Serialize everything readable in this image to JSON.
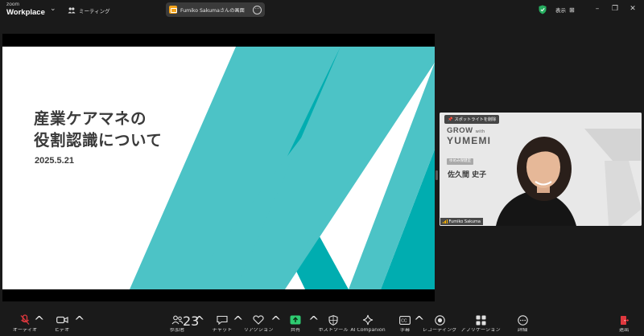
{
  "titlebar": {
    "brand_top": "zoom",
    "brand_bottom": "Workplace",
    "meeting_label": "ミーティング",
    "share_banner": "Fumiko Sakumaさんの画面",
    "view_label": "表示",
    "accent_shield": "#27ae60",
    "share_app_color": "#f4a31a"
  },
  "slide": {
    "title_line1": "産業ケアマネの",
    "title_line2": "役割認識について",
    "date": "2025.5.21",
    "teal_light": "#4cc3c6",
    "teal_dark": "#00adb0"
  },
  "video": {
    "spotlight_button": "スポットライトを削除",
    "logo_line1": "GROW",
    "logo_with": "with",
    "logo_line2": "YUMEMI",
    "role_badge": "ゆめみ保健室",
    "person_name": "佐久間 史子",
    "name_tag": "Fumiko Sakuma"
  },
  "toolbar": {
    "audio_label": "オーディオ",
    "video_label": "ビデオ",
    "participants_label": "参加者",
    "participants_count": "23",
    "chat_label": "チャット",
    "reactions_label": "リアクション",
    "share_label": "共有",
    "host_tools_label": "ホストツール",
    "ai_companion_label": "AI Companion",
    "captions_label": "字幕",
    "record_label": "レコーディング",
    "apps_label": "アプリケーション",
    "more_label": "詳細",
    "leave_label": "退出",
    "share_accent": "#2ecc71",
    "leave_accent": "#e0383e"
  }
}
